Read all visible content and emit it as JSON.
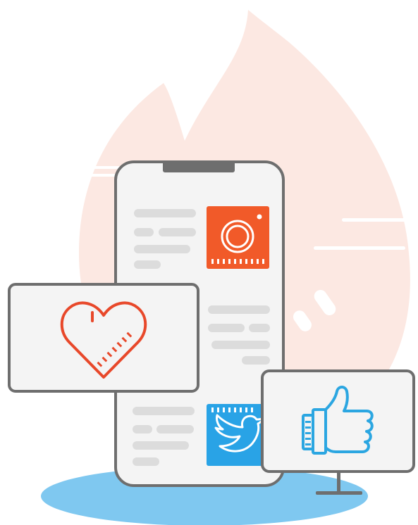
{
  "illustration": {
    "theme": "social-media-engagement",
    "colors": {
      "flame": "#FCE8E2",
      "flame_highlight": "#FFFFFF",
      "shadow": "#7FC8F0",
      "outline": "#6E6E6E",
      "screen_fill": "#F4F4F4",
      "card_fill": "#F4F4F4",
      "placeholder": "#DCDCDC",
      "instagram": "#F15A29",
      "twitter": "#29A3E6",
      "heart": "#E8482A",
      "thumbs_up": "#2BA6E1",
      "icon_white": "#FFFFFF"
    },
    "icons": [
      "flame-shape",
      "instagram-icon",
      "twitter-icon",
      "heart-icon",
      "thumbs-up-icon"
    ]
  }
}
